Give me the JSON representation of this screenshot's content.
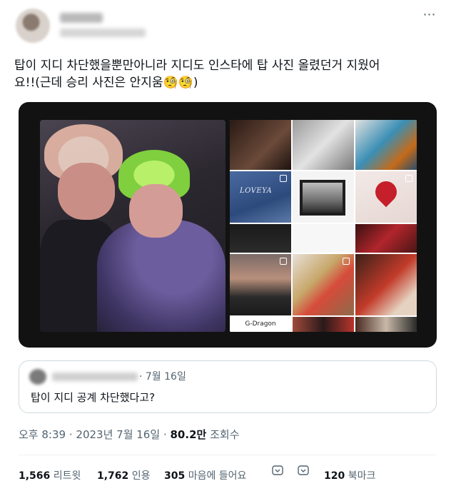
{
  "tweet": {
    "text_line1": "탑이 지디 차단했을뿐만아니라 지디도 인스타에 탑 사진 올렸던거 지웠어",
    "text_line2": "요!!(근데 승리 사진은 안지움",
    "text_line2_end": ")",
    "emoji": "🧐🧐"
  },
  "media": {
    "grid_label": "G-Dragon",
    "love_text": "LOVEYA"
  },
  "quoted_tweet": {
    "date": "· 7월 16일",
    "text": "탑이 지디 공계 차단했다고?"
  },
  "meta": {
    "time": "오후 8:39",
    "sep": "·",
    "date": "2023년 7월 16일",
    "views_value": "80.2만",
    "views_label": "조회수"
  },
  "stats": {
    "retweets_value": "1,566",
    "retweets_label": "리트윗",
    "quotes_value": "1,762",
    "quotes_label": "인용",
    "likes_value": "305",
    "likes_label": "마음에 들어요",
    "bookmarks_value": "120",
    "bookmarks_label": "북마크"
  },
  "icons": {
    "more": "more-horizontal-icon",
    "expand_a": "chevron-down-icon",
    "expand_b": "chevron-down-icon"
  }
}
